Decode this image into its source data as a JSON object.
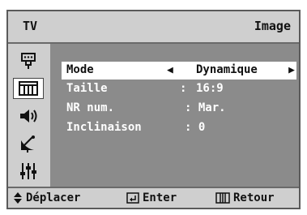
{
  "header": {
    "source": "TV",
    "title": "Image"
  },
  "sidebar": {
    "items": [
      {
        "icon": "input-icon"
      },
      {
        "icon": "picture-icon",
        "active": true
      },
      {
        "icon": "sound-icon"
      },
      {
        "icon": "channel-icon"
      },
      {
        "icon": "setup-icon"
      }
    ]
  },
  "menu": {
    "rows": [
      {
        "label": "Mode",
        "value": "Dynamique"
      },
      {
        "label": "Taille",
        "colon": ":",
        "value": "16:9"
      },
      {
        "label": "NR num.",
        "value": ": Mar."
      },
      {
        "label": "Inclinaison",
        "value": ": 0"
      }
    ]
  },
  "footer": {
    "move": "Déplacer",
    "enter": "Enter",
    "back": "Retour"
  }
}
